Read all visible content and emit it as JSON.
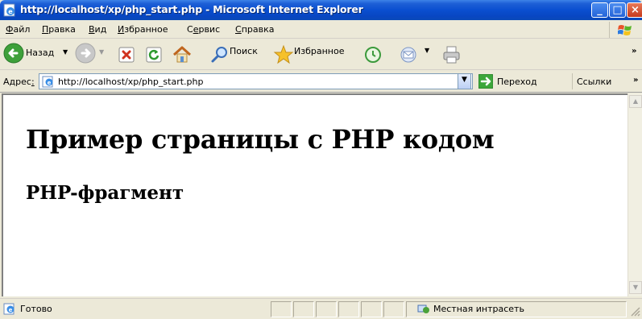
{
  "window": {
    "title": "http://localhost/xp/php_start.php - Microsoft Internet Explorer",
    "minimize_glyph": "_",
    "maximize_glyph": "□",
    "close_glyph": "×"
  },
  "menu": {
    "items": [
      {
        "label": "Файл",
        "accel": "Ф",
        "rest": "айл"
      },
      {
        "label": "Правка",
        "accel": "П",
        "rest": "равка"
      },
      {
        "label": "Вид",
        "accel": "В",
        "rest": "ид"
      },
      {
        "label": "Избранное",
        "accel": "И",
        "rest": "збранное"
      },
      {
        "label": "Сервис",
        "pre": "С",
        "accel": "е",
        "rest": "рвис"
      },
      {
        "label": "Справка",
        "accel": "С",
        "rest": "правка"
      }
    ]
  },
  "toolbar": {
    "back_label": "Назад",
    "search_label": "Поиск",
    "favorites_label": "Избранное",
    "more_glyph": "»"
  },
  "address": {
    "label_pre": "Адрес",
    "label_accel": "",
    "value": "http://localhost/xp/php_start.php",
    "go_label": "Переход",
    "links_label": "Ссылки",
    "more_glyph": "»"
  },
  "page": {
    "heading": "Пример страницы с PHP кодом",
    "subheading": "PHP-фрагмент"
  },
  "status": {
    "text": "Готово",
    "zone": "Местная интрасеть"
  },
  "colors": {
    "titlebar": "#0a4fd0",
    "chrome": "#ece9d8"
  }
}
